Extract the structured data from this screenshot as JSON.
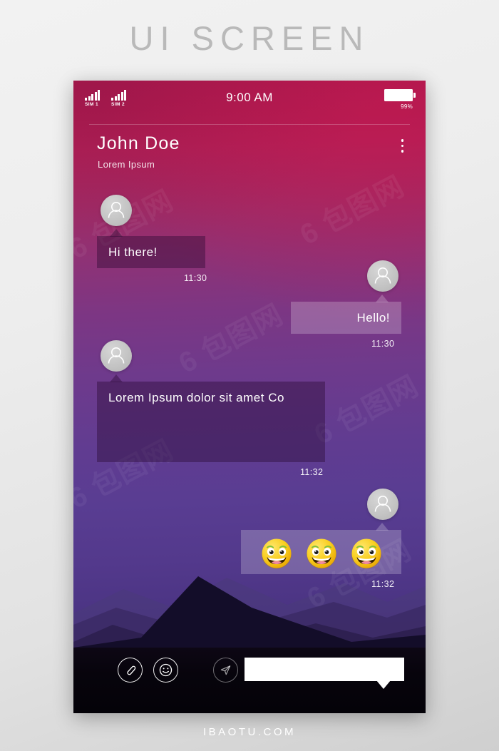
{
  "poster": {
    "title": "UI SCREEN",
    "footer": "IBAOTU.COM"
  },
  "colors": {
    "gradient_top": "#a4184c",
    "gradient_mid": "#7d3683",
    "gradient_bottom": "#1b1233",
    "bubble_received": "rgba(40,8,48,0.40)",
    "bubble_sent": "rgba(255,255,255,0.22)",
    "emoji_yellow": "#f7d117",
    "input_bar": "#07040c",
    "accent_white": "#ffffff"
  },
  "statusbar": {
    "sim1_label": "SIM 1",
    "sim2_label": "SIM 2",
    "signal_bars": 5,
    "time": "9:00 AM",
    "battery_percent": "99%",
    "battery_level": 99
  },
  "header": {
    "contact_name": "John Doe",
    "contact_status": "Lorem Ipsum",
    "menu_icon": "more-vertical-icon"
  },
  "messages": [
    {
      "id": "msg-1",
      "side": "received",
      "type": "text",
      "text": "Hi there!",
      "time": "11:30",
      "avatar_icon": "user-avatar-icon"
    },
    {
      "id": "msg-2",
      "side": "sent",
      "type": "text",
      "text": "Hello!",
      "time": "11:30",
      "avatar_icon": "user-avatar-icon"
    },
    {
      "id": "msg-3",
      "side": "received",
      "type": "text",
      "text": "Lorem Ipsum dolor sit amet Co",
      "time": "11:32",
      "avatar_icon": "user-avatar-icon"
    },
    {
      "id": "msg-4",
      "side": "sent",
      "type": "emoji",
      "emoji_count": 3,
      "emoji_name": "grinning-smiley-emoji",
      "time": "11:32",
      "avatar_icon": "user-avatar-icon"
    }
  ],
  "composer": {
    "attach_icon": "paperclip-icon",
    "emoji_icon": "smiley-icon",
    "send_icon": "send-paper-plane-icon",
    "input_value": "",
    "input_placeholder": ""
  },
  "watermarks": [
    "6 包图网",
    "6 包图网",
    "6 包图网",
    "6 包图网",
    "6 包图网",
    "6 包图网"
  ]
}
